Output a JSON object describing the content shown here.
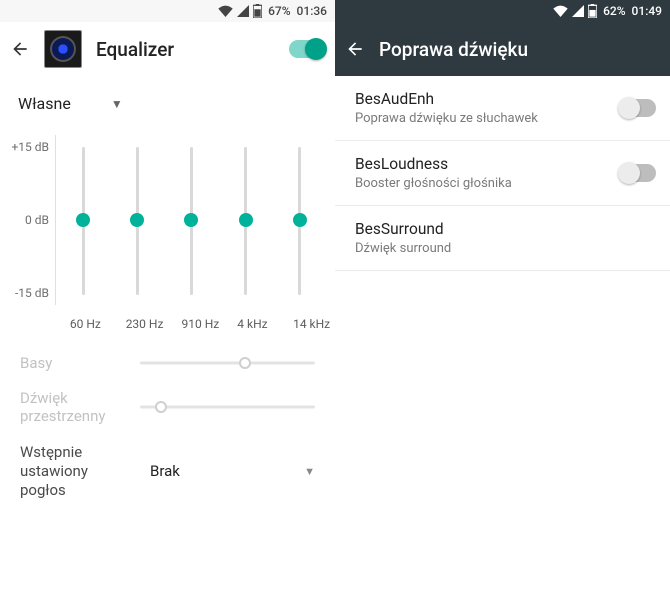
{
  "left": {
    "status": {
      "battery": "67%",
      "time": "01:36"
    },
    "title": "Equalizer",
    "enabled": true,
    "preset": "Własne",
    "yticks": {
      "top": "+15 dB",
      "mid": "0 dB",
      "bot": "-15 dB"
    },
    "bands": [
      "60 Hz",
      "230 Hz",
      "910 Hz",
      "4 kHz",
      "14 kHz"
    ],
    "bass": {
      "label": "Basy",
      "pos": 0.6
    },
    "spatial": {
      "label": "Dźwięk przestrzenny",
      "pos": 0.12
    },
    "reverb": {
      "label": "Wstępnie ustawiony pogłos",
      "value": "Brak"
    }
  },
  "right": {
    "status": {
      "battery": "62%",
      "time": "01:49"
    },
    "title": "Poprawa dźwięku",
    "items": [
      {
        "title": "BesAudEnh",
        "subtitle": "Poprawa dźwięku ze słuchawek",
        "toggle": false
      },
      {
        "title": "BesLoudness",
        "subtitle": "Booster głośności głośnika",
        "toggle": false
      },
      {
        "title": "BesSurround",
        "subtitle": "Dźwięk surround",
        "toggle": null
      }
    ]
  }
}
